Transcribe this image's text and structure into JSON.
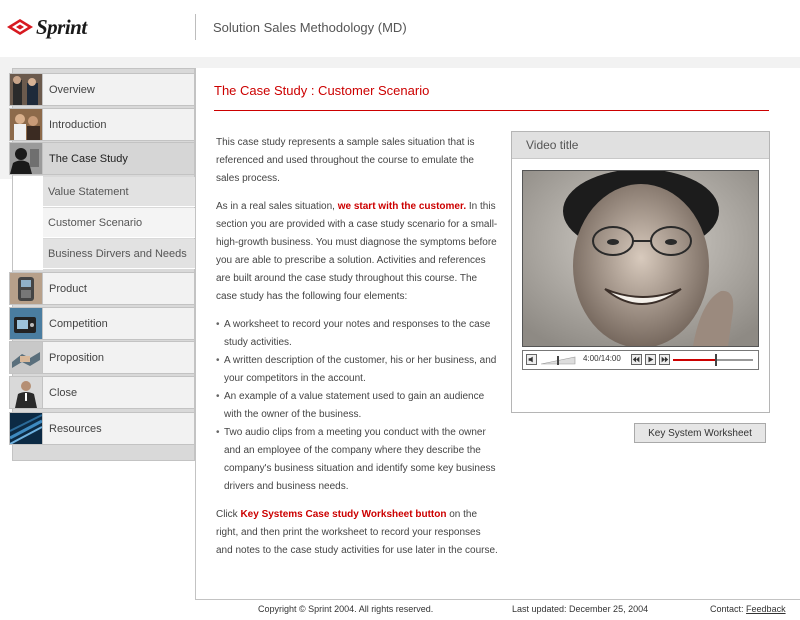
{
  "header": {
    "logo_text": "Sprint",
    "course_title": "Solution Sales Methodology (MD)",
    "brand_red": "#d71920"
  },
  "sidebar": {
    "items": [
      {
        "label": "Overview",
        "icon": "business-people-icon"
      },
      {
        "label": "Introduction",
        "icon": "meeting-icon"
      },
      {
        "label": "The Case Study",
        "icon": "silhouette-icon",
        "active": true
      },
      {
        "label": "Product",
        "icon": "phone-icon"
      },
      {
        "label": "Competition",
        "icon": "device-icon"
      },
      {
        "label": "Proposition",
        "icon": "handshake-icon"
      },
      {
        "label": "Close",
        "icon": "executive-icon"
      },
      {
        "label": "Resources",
        "icon": "www-icon"
      }
    ],
    "sub_items": [
      {
        "label": "Value Statement"
      },
      {
        "label": "Customer Scenario",
        "current": true
      },
      {
        "label": "Business Dirvers and Needs"
      }
    ]
  },
  "main": {
    "title": "The Case Study : Customer Scenario",
    "para1": "This case study represents a sample sales situation that is referenced and used throughout the course to emulate the sales process.",
    "para2_before": "As in a real sales situation, ",
    "para2_highlight": "we start with the customer.",
    "para2_after": " In this section you are provided with a case study scenario for a small-high-growth business. You must diagnose the symptoms before you are able to prescribe a solution. Activities and references are built around the case study throughout this course. The case study has the following four elements:",
    "bullets": [
      "A worksheet to record your notes and responses to the case study activities.",
      "A written description of the customer, his or her business, and your competitors in the account.",
      "An example of a value statement used to gain an audience with the owner of the business.",
      "Two audio clips from a meeting you conduct with the owner and an employee of the company where they describe the company's business situation and identify some key business drivers and business needs."
    ],
    "para3_before": "Click ",
    "para3_highlight": "Key Systems Case study Worksheet button",
    "para3_after": " on the right, and then print the worksheet to record your responses and notes to the case study activities for use later in the course."
  },
  "video": {
    "title": "Video title",
    "time": "4:00/14:00",
    "progress": 0.52
  },
  "worksheet_button": "Key System Worksheet",
  "footer": {
    "copyright": "Copyright © Sprint 2004. All rights reserved.",
    "updated": "Last  updated: December 25, 2004",
    "contact": "Contact:",
    "feedback": "Feedback"
  }
}
